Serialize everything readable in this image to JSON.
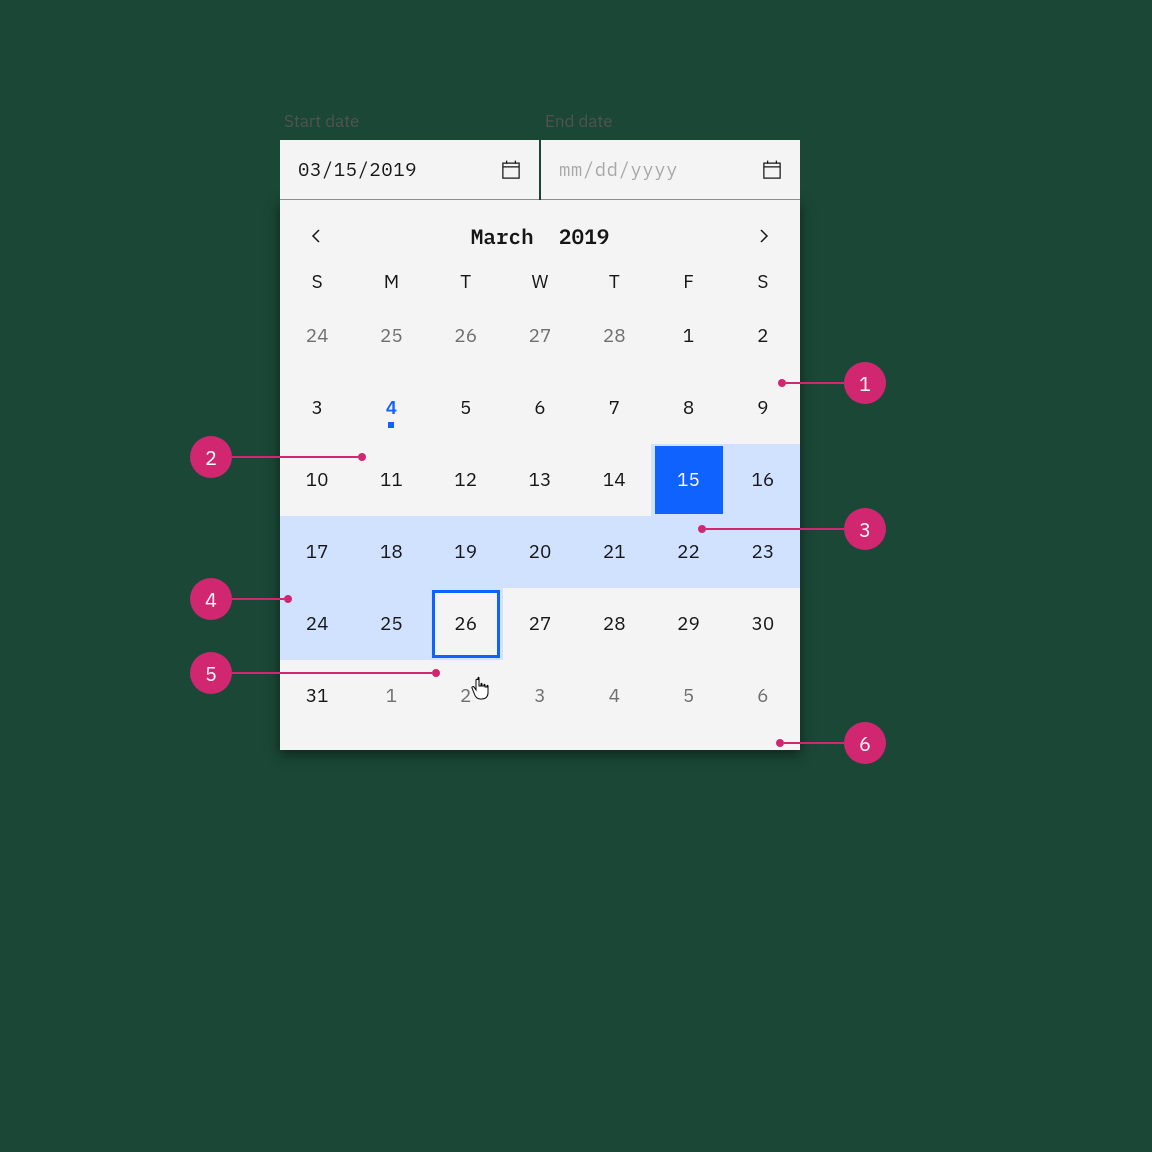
{
  "labels": {
    "start": "Start date",
    "end": "End date"
  },
  "inputs": {
    "start_value": "03/15/2019",
    "end_placeholder": "mm/dd/yyyy"
  },
  "header": {
    "month": "March",
    "year": "2019"
  },
  "dow": [
    "S",
    "M",
    "T",
    "W",
    "T",
    "F",
    "S"
  ],
  "days": [
    [
      {
        "n": "24",
        "muted": true
      },
      {
        "n": "25",
        "muted": true
      },
      {
        "n": "26",
        "muted": true
      },
      {
        "n": "27",
        "muted": true
      },
      {
        "n": "28",
        "muted": true
      },
      {
        "n": "1"
      },
      {
        "n": "2"
      }
    ],
    [
      {
        "n": "3"
      },
      {
        "n": "4",
        "today": true
      },
      {
        "n": "5"
      },
      {
        "n": "6"
      },
      {
        "n": "7"
      },
      {
        "n": "8"
      },
      {
        "n": "9"
      }
    ],
    [
      {
        "n": "10"
      },
      {
        "n": "11"
      },
      {
        "n": "12"
      },
      {
        "n": "13"
      },
      {
        "n": "14"
      },
      {
        "n": "15",
        "selected": true,
        "range": true
      },
      {
        "n": "16",
        "range": true
      }
    ],
    [
      {
        "n": "17",
        "range": true
      },
      {
        "n": "18",
        "range": true
      },
      {
        "n": "19",
        "range": true
      },
      {
        "n": "20",
        "range": true
      },
      {
        "n": "21",
        "range": true
      },
      {
        "n": "22",
        "range": true
      },
      {
        "n": "23",
        "range": true
      }
    ],
    [
      {
        "n": "24",
        "range": true
      },
      {
        "n": "25",
        "range": true
      },
      {
        "n": "26",
        "range": true,
        "hovered": true
      },
      {
        "n": "27"
      },
      {
        "n": "28"
      },
      {
        "n": "29"
      },
      {
        "n": "30"
      }
    ],
    [
      {
        "n": "31"
      },
      {
        "n": "1",
        "muted": true
      },
      {
        "n": "2",
        "muted": true
      },
      {
        "n": "3",
        "muted": true
      },
      {
        "n": "4",
        "muted": true
      },
      {
        "n": "5",
        "muted": true
      },
      {
        "n": "6",
        "muted": true
      }
    ]
  ],
  "annotations": [
    {
      "id": "1"
    },
    {
      "id": "2"
    },
    {
      "id": "3"
    },
    {
      "id": "4"
    },
    {
      "id": "5"
    },
    {
      "id": "6"
    }
  ]
}
